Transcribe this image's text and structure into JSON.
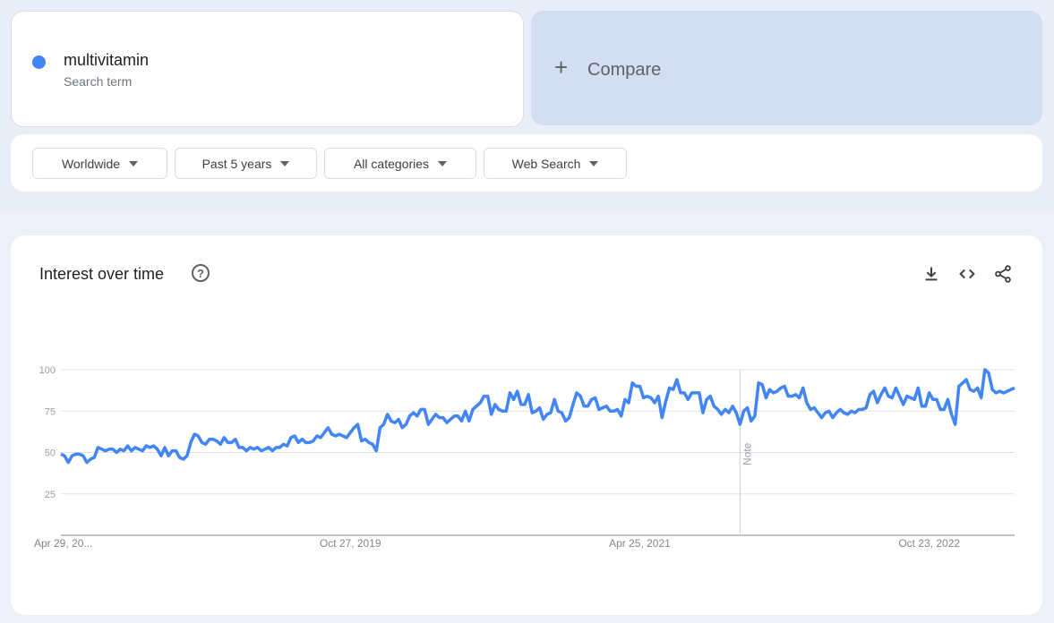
{
  "search_term": {
    "name": "multivitamin",
    "sublabel": "Search term",
    "color": "#4285f4"
  },
  "compare": {
    "icon": "plus-icon",
    "label": "Compare"
  },
  "filters": [
    {
      "label": "Worldwide"
    },
    {
      "label": "Past 5 years"
    },
    {
      "label": "All categories"
    },
    {
      "label": "Web Search"
    }
  ],
  "chart_panel": {
    "title": "Interest over time",
    "help_icon": "help-icon",
    "actions": [
      "download-icon",
      "embed-code-icon",
      "share-icon"
    ]
  },
  "chart_data": {
    "type": "line",
    "title": "Interest over time",
    "xlabel": "",
    "ylabel": "",
    "ylim": [
      0,
      100
    ],
    "yticks": [
      25,
      50,
      75,
      100
    ],
    "xtick_labels": [
      "Apr 29, 20...",
      "Oct 27, 2019",
      "Apr 25, 2021",
      "Oct 23, 2022"
    ],
    "xtick_positions": [
      0,
      78,
      156,
      234
    ],
    "grid": true,
    "annotation": {
      "label": "Note",
      "index": 183
    },
    "series": [
      {
        "name": "multivitamin",
        "color": "#4285f4",
        "values": [
          49,
          48,
          44,
          48,
          49,
          49,
          48,
          44,
          46,
          47,
          53,
          52,
          51,
          52,
          52,
          50,
          52,
          51,
          54,
          51,
          53,
          52,
          51,
          54,
          53,
          54,
          52,
          48,
          53,
          48,
          51,
          51,
          47,
          46,
          48,
          56,
          61,
          60,
          56,
          55,
          58,
          58,
          57,
          55,
          59,
          56,
          56,
          58,
          53,
          53,
          51,
          53,
          52,
          53,
          51,
          52,
          53,
          51,
          53,
          53,
          55,
          54,
          59,
          60,
          56,
          58,
          56,
          56,
          57,
          60,
          59,
          62,
          65,
          61,
          60,
          61,
          60,
          59,
          62,
          65,
          67,
          57,
          58,
          56,
          55,
          51,
          65,
          67,
          73,
          69,
          68,
          70,
          65,
          67,
          72,
          74,
          72,
          76,
          76,
          67,
          70,
          73,
          71,
          71,
          68,
          70,
          72,
          72,
          69,
          75,
          69,
          76,
          78,
          80,
          84,
          84,
          73,
          79,
          76,
          75,
          75,
          86,
          82,
          87,
          79,
          79,
          85,
          74,
          75,
          77,
          70,
          73,
          74,
          82,
          75,
          74,
          69,
          71,
          79,
          86,
          84,
          78,
          78,
          82,
          83,
          76,
          77,
          78,
          75,
          75,
          76,
          72,
          82,
          80,
          92,
          90,
          90,
          83,
          84,
          83,
          80,
          84,
          71,
          81,
          89,
          88,
          94,
          86,
          86,
          82,
          86,
          86,
          86,
          74,
          82,
          84,
          78,
          76,
          73,
          76,
          74,
          78,
          74,
          67,
          75,
          77,
          69,
          72,
          92,
          91,
          83,
          88,
          86,
          87,
          89,
          90,
          84,
          84,
          85,
          83,
          89,
          80,
          76,
          77,
          74,
          71,
          74,
          75,
          71,
          74,
          76,
          74,
          73,
          75,
          74,
          76,
          76,
          77,
          85,
          87,
          80,
          85,
          89,
          84,
          83,
          89,
          84,
          79,
          84,
          83,
          82,
          89,
          78,
          78,
          86,
          82,
          82,
          76,
          76,
          82,
          73,
          67,
          90,
          92,
          94,
          88,
          87,
          89,
          83,
          100,
          98,
          88,
          86,
          87,
          86,
          87,
          88,
          89
        ]
      }
    ]
  }
}
